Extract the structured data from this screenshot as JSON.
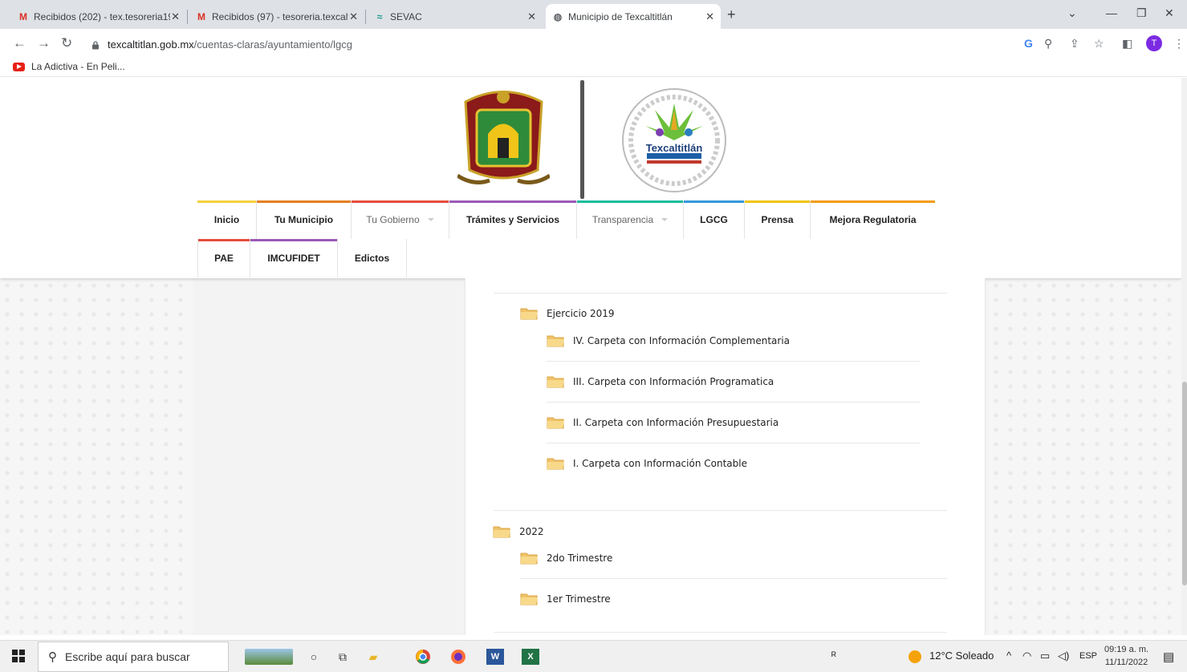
{
  "browser": {
    "tabs": [
      {
        "title": "Recibidos (202) - tex.tesoreria19...",
        "favicon": "gmail-icon"
      },
      {
        "title": "Recibidos (97) - tesoreria.texcaltl...",
        "favicon": "gmail-icon"
      },
      {
        "title": "SEVAC",
        "favicon": "sevac-icon"
      },
      {
        "title": "Municipio de Texcaltitlán",
        "favicon": "globe-icon",
        "active": true
      }
    ],
    "url_host": "texcaltitlan.gob.mx",
    "url_path": "/cuentas-claras/ayuntamiento/lgcg",
    "bookmark": "La Adictiva - En Peli...",
    "profile_initial": "T"
  },
  "site": {
    "logo2_text": "Texcaltitlán",
    "menu_row1": [
      {
        "label": "Inicio",
        "bar": "#f4d03f",
        "style": "bold"
      },
      {
        "label": "Tu Municipio",
        "bar": "#e67e22",
        "style": "bold"
      },
      {
        "label": "Tu Gobierno",
        "bar": "#e74c3c",
        "style": "light",
        "caret": true
      },
      {
        "label": "Trámites y Servicios",
        "bar": "#9b59b6",
        "style": "bold"
      },
      {
        "label": "Transparencia",
        "bar": "#1abc9c",
        "style": "light",
        "caret": true
      },
      {
        "label": "LGCG",
        "bar": "#3498db",
        "style": "bold"
      },
      {
        "label": "Prensa",
        "bar": "#f1c40f",
        "style": "bold"
      },
      {
        "label": "Mejora Regulatoria",
        "bar": "#f39c12",
        "style": "bold"
      }
    ],
    "menu_row2": [
      {
        "label": "PAE",
        "bar": "#e74c3c"
      },
      {
        "label": "IMCUFIDET",
        "bar": "#9b59b6"
      },
      {
        "label": "Edictos",
        "bar": ""
      }
    ]
  },
  "tree": {
    "ejercicio_2019": "Ejercicio 2019",
    "carpetas": [
      "IV. Carpeta con Información Complementaria",
      "III. Carpeta con Información Programatica",
      "II. Carpeta con Información Presupuestaria",
      "I. Carpeta con Información Contable"
    ],
    "year_2022": "2022",
    "trimestres": [
      "2do Trimestre",
      "1er Trimestre"
    ]
  },
  "taskbar": {
    "search_placeholder": "Escribe aquí para buscar",
    "weather": "12°C Soleado",
    "lang": "ESP",
    "time": "09:19 a. m.",
    "date": "11/11/2022"
  }
}
